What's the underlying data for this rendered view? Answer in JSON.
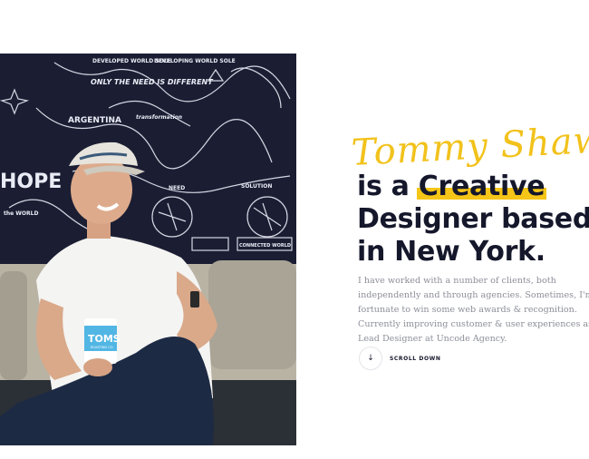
{
  "hero": {
    "signature": "Tommy Shaw",
    "headline": {
      "line1_prefix": "is a ",
      "line1_highlight": "Creative",
      "line2": "Designer based",
      "line3": "in New York."
    },
    "bio": "I have worked with a number of clients, both independently and through agencies. Sometimes, I'm fortunate to win some web awards & recognition. Currently improving customer & user experiences as Lead Designer at Uncode Agency.",
    "scroll": {
      "icon": "↓",
      "label": "SCROLL DOWN"
    }
  },
  "photo": {
    "mural_texts": [
      "DEVELOPED WORLD SOLE",
      "DEVELOPING WORLD SOLE",
      "ONLY THE NEED IS DIFFERENT",
      "ARGENTINA",
      "transformation",
      "NEED",
      "SOLUTION",
      "CONNECTED WORLD",
      "HOPE",
      "the WORLD"
    ],
    "cup_brand": "TOMS",
    "cup_sub": "ROASTING CO."
  },
  "colors": {
    "accent": "#f5c518",
    "signature": "#f2c21b",
    "heading": "#15172b",
    "body": "#8d8f99"
  }
}
